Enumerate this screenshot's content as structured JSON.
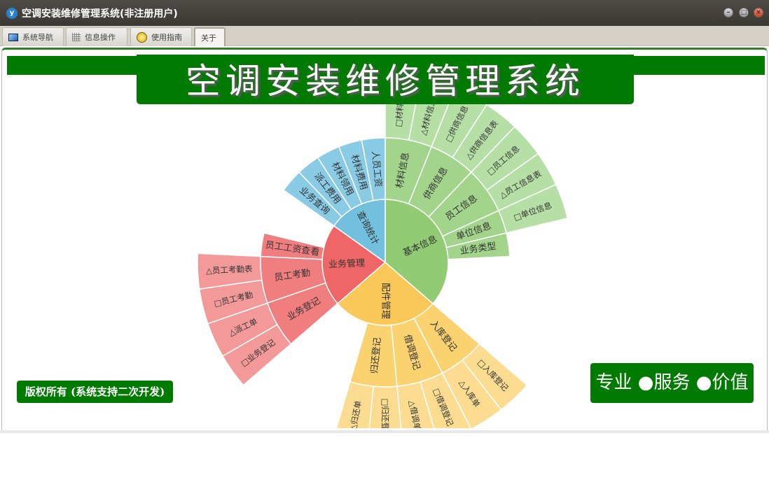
{
  "window": {
    "title": "空调安装维修管理系统(非注册用户)"
  },
  "tabs": [
    {
      "label": "系统导航",
      "icon": "monitor-icon"
    },
    {
      "label": "信息操作",
      "icon": "grid-icon"
    },
    {
      "label": "使用指南",
      "icon": "help-icon"
    },
    {
      "label": "关于",
      "icon": ""
    }
  ],
  "header": {
    "title": "空调安装维修管理系统"
  },
  "footer": {
    "copyright": "版权所有 (系统支持二次开发)",
    "slogan": "专业 ●服务 ●价值"
  },
  "chart_data": {
    "type": "sunburst",
    "colors": {
      "green": [
        "#91cc75",
        "#a2d48b",
        "#b6dfa5"
      ],
      "yellow": [
        "#fac858",
        "#fad270",
        "#fbdc91"
      ],
      "red": [
        "#ee6666",
        "#f07e7e",
        "#f39999"
      ],
      "blue": [
        "#73c0de",
        "#89cae5",
        "#89cae5"
      ]
    },
    "tree": [
      {
        "name": "基本信息",
        "value": 12,
        "color": "green",
        "children": [
          {
            "name": "材料信息",
            "value": 2,
            "children": [
              {
                "name": "□材料信息",
                "value": 1
              },
              {
                "name": "△材料信息表",
                "value": 1
              }
            ]
          },
          {
            "name": "供商信息",
            "value": 2,
            "children": [
              {
                "name": "□供商信息",
                "value": 1
              },
              {
                "name": "△供商信息表",
                "value": 1
              }
            ]
          },
          {
            "name": "员工信息",
            "value": 2,
            "children": [
              {
                "name": "□员工信息",
                "value": 1
              },
              {
                "name": "△员工信息表",
                "value": 1
              }
            ]
          },
          {
            "name": "单位信息",
            "value": 1,
            "children": [
              {
                "name": "□单位信息",
                "value": 1
              }
            ]
          },
          {
            "name": "业务类型",
            "value": 1
          }
        ]
      },
      {
        "name": "配件管理",
        "value": 9,
        "color": "yellow",
        "children": [
          {
            "name": "入库登记",
            "value": 2,
            "children": [
              {
                "name": "□入库登记",
                "value": 1
              },
              {
                "name": "△入库单",
                "value": 1
              }
            ]
          },
          {
            "name": "借调登记",
            "value": 2,
            "children": [
              {
                "name": "□借调登记",
                "value": 1
              },
              {
                "name": "△借调单",
                "value": 1
              }
            ]
          },
          {
            "name": "归还登记",
            "value": 2,
            "children": [
              {
                "name": "□归还登记",
                "value": 1
              },
              {
                "name": "△归还单",
                "value": 1
              }
            ]
          }
        ]
      },
      {
        "name": "业务管理",
        "value": 7,
        "color": "red",
        "children": [
          {
            "name": "业务登记",
            "value": 2,
            "children": [
              {
                "name": "□业务登记",
                "value": 1
              },
              {
                "name": "△派工单",
                "value": 1
              }
            ]
          },
          {
            "name": "员工考勤",
            "value": 2,
            "children": [
              {
                "name": "□员工考勤",
                "value": 1
              },
              {
                "name": "△员工考勤表",
                "value": 1
              }
            ]
          },
          {
            "name": "员工工资查看",
            "value": 1
          }
        ]
      },
      {
        "name": "查询统计",
        "value": 5,
        "color": "blue",
        "children": [
          {
            "name": "业务查询",
            "value": 1
          },
          {
            "name": "派工费用",
            "value": 1
          },
          {
            "name": "材料领用",
            "value": 1
          },
          {
            "name": "材料费用",
            "value": 1
          },
          {
            "name": "人员工资",
            "value": 1
          }
        ]
      }
    ]
  }
}
